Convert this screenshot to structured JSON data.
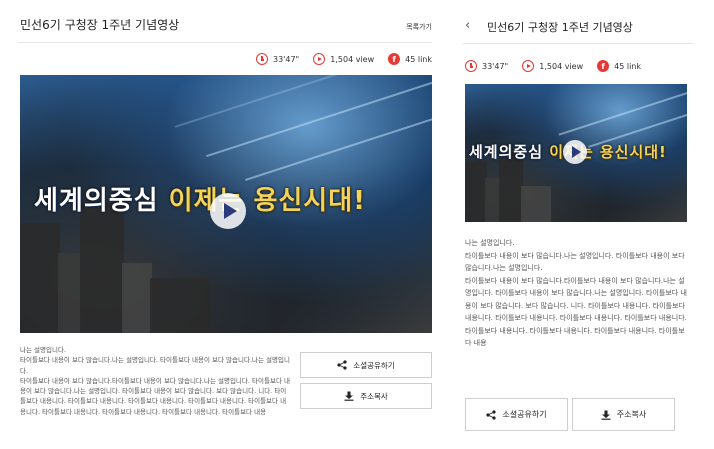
{
  "left": {
    "title": "민선6기 구청장 1주년 기념영상",
    "list_link": "목록가기",
    "stats": {
      "duration": "33'47\"",
      "views": "1,504 view",
      "links": "45 link"
    },
    "video_title": {
      "part1": "세계의중심 ",
      "part2": "이제는 용신시대!"
    },
    "description": [
      "나는 설명입니다.",
      "타이틀보다 내용이 보다 많습니다.나는 설명입니다. 타이틀보다 내용이 보다 많습니다.나는 설명입니다.",
      "타이틀보다 내용이 보다 많습니다.타이틀보다 내용이 보다 많습니다.나는 설명입니다. 타이틀보다 내용이 보다 많습니다.나는 설명입니다. 타이틀보다 내용이 보다 많습니다. 보다 많습니다. 니다. 타이틀보다 내용니다. 타이틀보다 내용니다. 타이틀보다 내용니다. 타이틀보다 내용니다. 타이틀보다 내용니다. 타이틀보다 내용니다. 타이틀보다 내용니다. 타이틀보다 내용니다. 타이틀보다 내용"
    ],
    "share_button": "소셜공유하기",
    "copy_button": "주소복사"
  },
  "right": {
    "title": "민선6기 구청장 1주년 기념영상",
    "back_glyph": "‹",
    "stats": {
      "duration": "33'47\"",
      "views": "1,504 view",
      "links": "45 link"
    },
    "video_title": {
      "part1": "세계의중심 ",
      "part2": "이제는 용신시대!"
    },
    "description": [
      "나는 설명입니다.",
      "타이틀보다 내용이 보다 많습니다.나는 설명입니다. 타이틀보다 내용이 보다 많습니다.나는 설명입니다.",
      "타이틀보다 내용이 보다 많습니다.타이틀보다 내용이 보다 많습니다.나는 설명입니다. 타이틀보다 내용이 보다 많습니다.나는 설명입니다. 타이틀보다 내용이 보다 많습니다. 보다 많습니다. 니다. 타이틀보다 내용니다. 타이틀보다 내용니다. 타이틀보다 내용니다. 타이틀보다 내용니다. 타이틀보다 내용니다. 타이틀보다 내용니다. 타이틀보다 내용니다. 타이틀보다 내용니다. 타이틀보다 내용"
    ],
    "share_button": "소셜공유하기",
    "copy_button": "주소복사"
  },
  "icons": {
    "clock": "clock-icon",
    "play": "play-icon",
    "facebook": "facebook-icon",
    "share": "share-icon",
    "download": "download-icon"
  },
  "colors": {
    "accent": "#e53935",
    "play_triangle": "#2a3a7a",
    "title_gold": "#f2d35c"
  }
}
